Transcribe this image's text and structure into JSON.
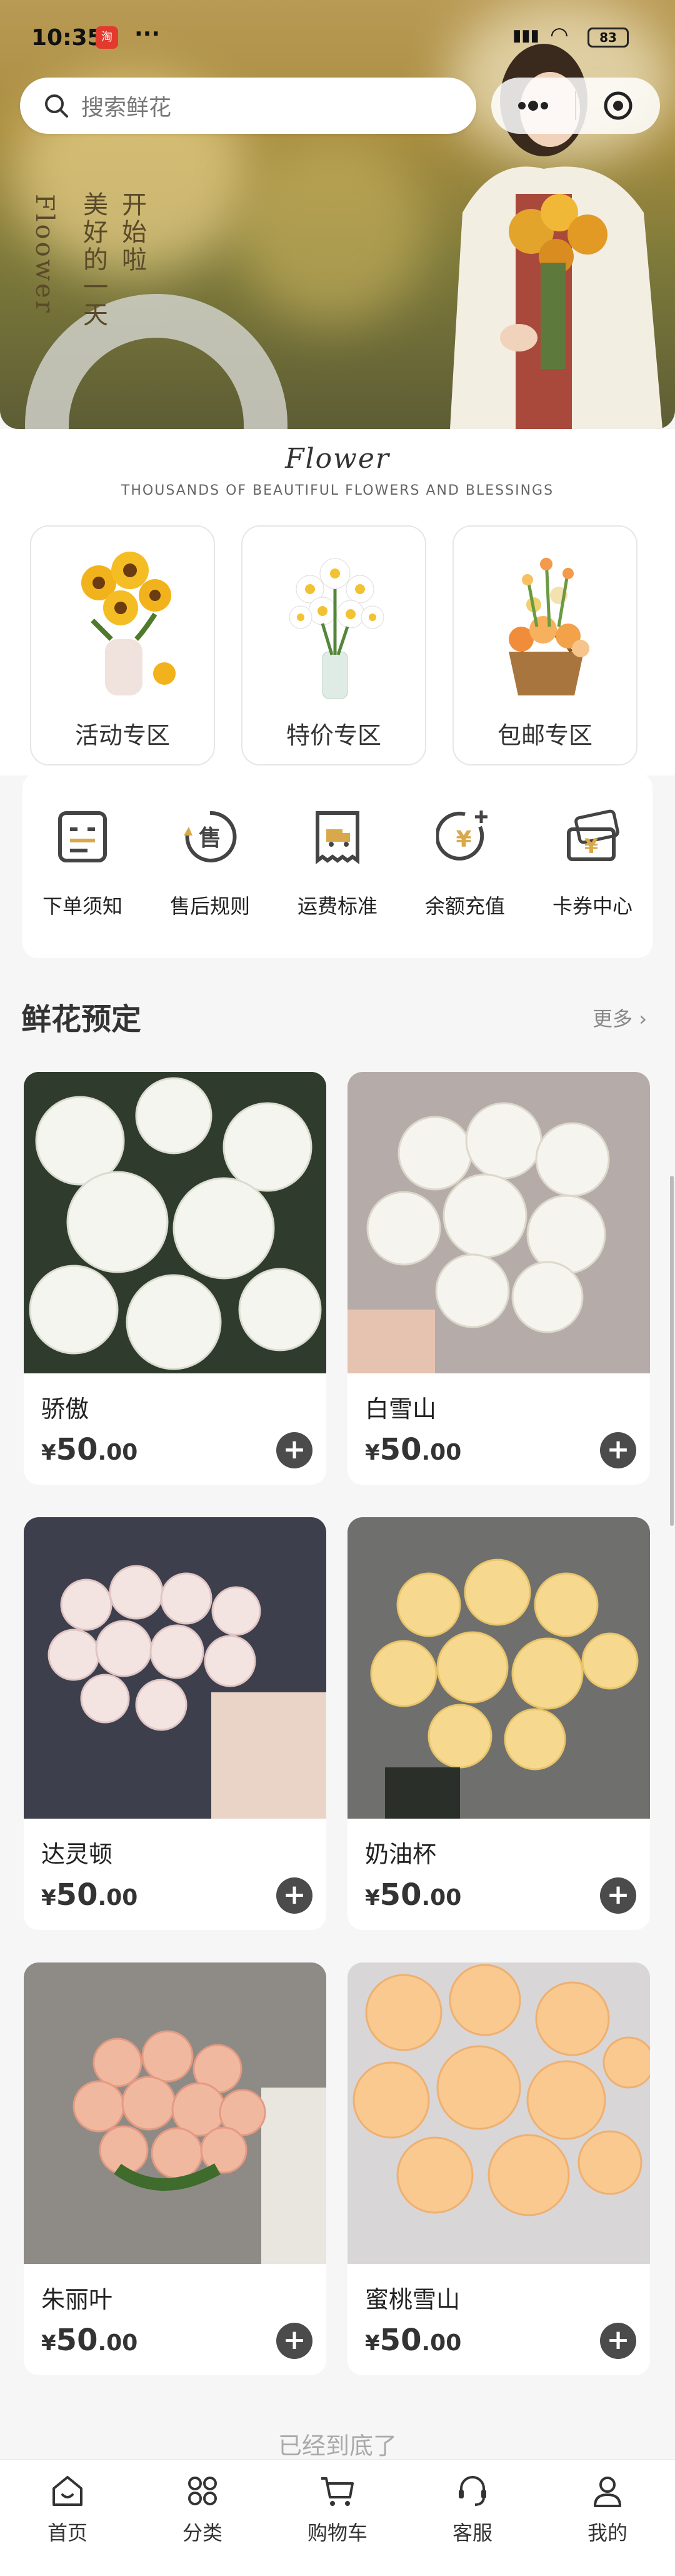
{
  "status": {
    "time": "10:35",
    "badge": "淘",
    "dots": "···",
    "signal": "il",
    "battery": "83"
  },
  "search": {
    "placeholder": "搜索鲜花"
  },
  "hero": {
    "vertical_1": "Floower",
    "vertical_2": "美好的一天",
    "vertical_3": "开始啦"
  },
  "brand": {
    "script": "Flower",
    "tagline": "THOUSANDS OF BEAUTIFUL FLOWERS AND BLESSINGS"
  },
  "categories": [
    {
      "label": "活动专区",
      "icon": "sunflower-vase-icon"
    },
    {
      "label": "特价专区",
      "icon": "daisy-vase-icon"
    },
    {
      "label": "包邮专区",
      "icon": "flower-basket-icon"
    }
  ],
  "services": [
    {
      "label": "下单须知",
      "icon": "order-notice-icon"
    },
    {
      "label": "售后规则",
      "icon": "after-sales-icon"
    },
    {
      "label": "运费标准",
      "icon": "shipping-fee-icon"
    },
    {
      "label": "余额充值",
      "icon": "recharge-icon"
    },
    {
      "label": "卡券中心",
      "icon": "coupon-icon"
    }
  ],
  "section": {
    "title": "鲜花预定",
    "more": "更多"
  },
  "products": [
    {
      "name": "骄傲",
      "currency": "¥",
      "price": "50",
      "decimals": ".00",
      "color": "#f4f5ee"
    },
    {
      "name": "白雪山",
      "currency": "¥",
      "price": "50",
      "decimals": ".00",
      "color": "#f6f4ee"
    },
    {
      "name": "达灵顿",
      "currency": "¥",
      "price": "50",
      "decimals": ".00",
      "color": "#f3e4e2"
    },
    {
      "name": "奶油杯",
      "currency": "¥",
      "price": "50",
      "decimals": ".00",
      "color": "#f6d98f"
    },
    {
      "name": "朱丽叶",
      "currency": "¥",
      "price": "50",
      "decimals": ".00",
      "color": "#f1b8a0"
    },
    {
      "name": "蜜桃雪山",
      "currency": "¥",
      "price": "50",
      "decimals": ".00",
      "color": "#f9c98f"
    }
  ],
  "end_text": "已经到底了",
  "tabs": [
    {
      "label": "首页",
      "icon": "home-icon"
    },
    {
      "label": "分类",
      "icon": "category-icon"
    },
    {
      "label": "购物车",
      "icon": "cart-icon"
    },
    {
      "label": "客服",
      "icon": "customer-service-icon"
    },
    {
      "label": "我的",
      "icon": "profile-icon"
    }
  ]
}
